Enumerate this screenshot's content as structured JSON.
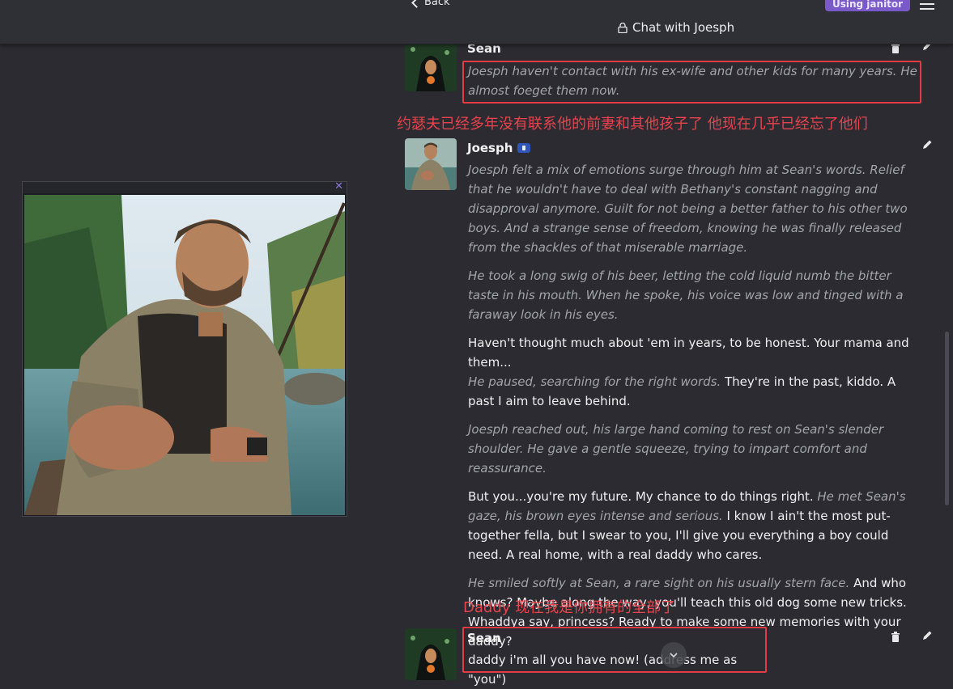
{
  "header": {
    "back_label": "Back",
    "title": "Chat with Joesph",
    "badge": "Using janitor"
  },
  "annotations": {
    "cn_note_1": "约瑟夫已经多年没有联系他的前妻和其他孩子了 他现在几乎已经忘了他们",
    "cn_note_2": "Daddy 现在我是你拥有的全部了"
  },
  "messages": [
    {
      "author": "Sean",
      "text": "Joesph haven't contact with his ex-wife and other kids for many years. He almost foeget them now."
    },
    {
      "author": "Joesph",
      "p1": "Joesph felt a mix of emotions surge through him at Sean's words. Relief that he wouldn't have to deal with Bethany's constant nagging and disapproval anymore. Guilt for not being a better father to his other two boys. And a strange sense of freedom, knowing he was finally released from the shackles of that miserable marriage.",
      "p2": "He took a long swig of his beer, letting the cold liquid numb the bitter taste in his mouth. When he spoke, his voice was low and tinged with a faraway look in his eyes.",
      "p3a": "Haven't thought much about 'em in years, to be honest. Your mama and them...",
      "p3b": "He paused, searching for the right words.",
      "p3c": "They're in the past, kiddo. A past I aim to leave behind.",
      "p4": "Joesph reached out, his large hand coming to rest on Sean's slender shoulder. He gave a gentle squeeze, trying to impart comfort and reassurance.",
      "p5a": "But you...you're my future. My chance to do things right.",
      "p5b": "He met Sean's gaze, his brown eyes intense and serious.",
      "p5c": "I know I ain't the most put-together fella, but I swear to you, I'll give you everything a boy could need. A real home, with a real daddy who cares.",
      "p6a": "He smiled softly at Sean, a rare sight on his usually stern face.",
      "p6b": "And who knows? Maybe along the way, you'll teach this old dog some new tricks. Whaddya say, princess? Ready to make some new memories with your daddy?"
    },
    {
      "author": "Sean",
      "text": "daddy i'm all you have now! (address me as \"you\")"
    }
  ],
  "colors": {
    "background": "#2b2b31",
    "accent_badge": "#7a5ac9",
    "annotation_red": "#e23b45",
    "action_text": "#a3a4aa"
  },
  "icons": [
    "chevron-left-icon",
    "lock-icon",
    "menu-icon",
    "close-icon",
    "pencil-icon",
    "trash-icon",
    "verified-icon",
    "chevron-down-icon"
  ]
}
